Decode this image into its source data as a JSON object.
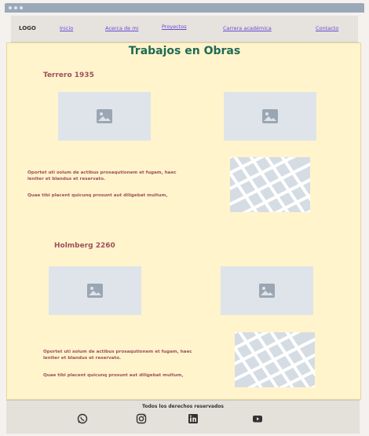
{
  "nav": {
    "logo": "LOGO",
    "links": [
      "Inicio",
      "Acerca de mi",
      "Proyectos",
      "Carrera académica",
      "Contacto"
    ]
  },
  "main": {
    "title": "Trabajos en Obras",
    "sections": [
      {
        "title": "Terrero 1935",
        "para1": "Oportet uti solum de actibus prosaqutionem et fugam, haec leniter et blandus et reservato.",
        "para2": "Quae tibi placent quicunq prosunt aut diligebat multum,"
      },
      {
        "title": "Holmberg 2260",
        "para1": "Oportet uti solum de actibus prosaqutionem et fugam, haec leniter et blandus et reservato.",
        "para2": "Quae tibi placent quicunq prosunt aut diligebat multum,"
      }
    ]
  },
  "footer": {
    "copyright": "Todos los derechos reservados",
    "social_icons": [
      "whatsapp-icon",
      "instagram-icon",
      "linkedin-icon",
      "youtube-icon"
    ]
  },
  "colors": {
    "title": "#1f6a55",
    "section": "#a04e5b",
    "link": "#6a4bd6",
    "background": "#fff4cc"
  }
}
